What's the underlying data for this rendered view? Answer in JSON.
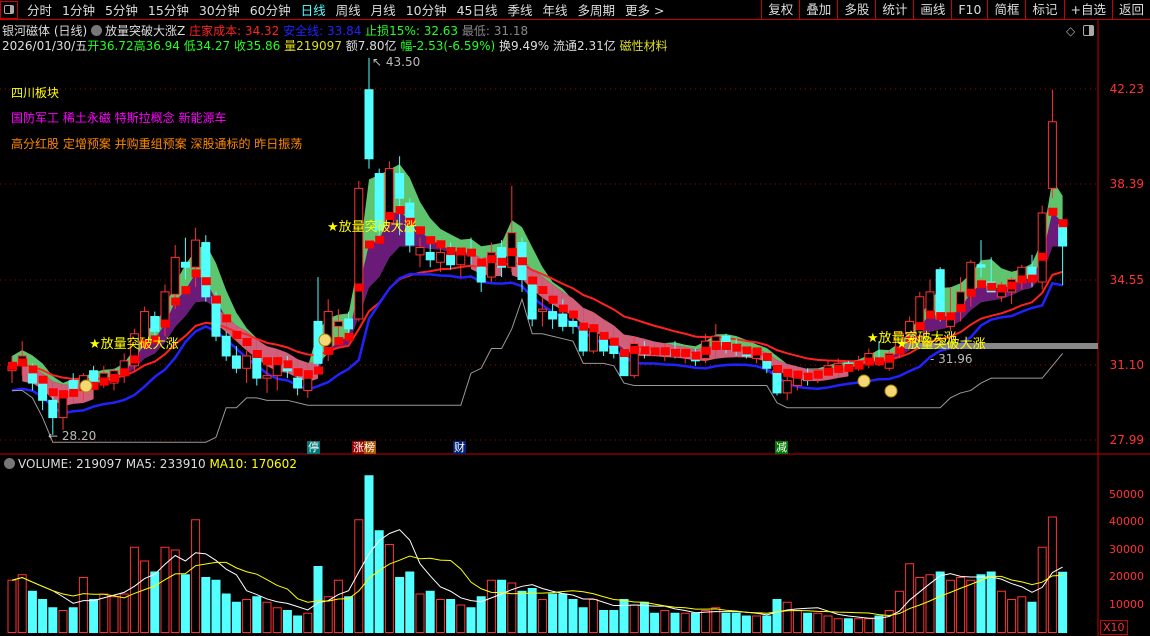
{
  "toolbar": {
    "periods": [
      "分时",
      "1分钟",
      "5分钟",
      "15分钟",
      "30分钟",
      "60分钟",
      "日线",
      "周线",
      "月线",
      "10分钟",
      "45日线",
      "季线",
      "年线",
      "多周期",
      "更多 >"
    ],
    "active": "日线",
    "right_buttons": [
      "复权",
      "叠加",
      "多股",
      "统计",
      "画线",
      "F10",
      "简框",
      "标记",
      "+自选",
      "返回"
    ]
  },
  "info": {
    "name": "银河磁体 (日线)",
    "indicator": "放量突破大涨Z",
    "cost_label": "庄家成本: 34.32",
    "safe_label": "安全线: 33.84",
    "stop_label": "止损15%: 32.63",
    "low_label": "最低: 31.18",
    "date": "2026/01/30/五",
    "open": "开36.72",
    "high": "高36.94",
    "low": "低34.27",
    "close": "收35.86",
    "vol": "量219097",
    "amount": "额7.80亿",
    "change": "幅-2.53(-6.59%)",
    "turnover": "换9.49%",
    "float": "流通2.31亿",
    "sector": "磁性材料"
  },
  "tags": {
    "line1": "四川板块",
    "line2": "国防军工 稀土永磁 特斯拉概念 新能源车",
    "line3": "高分红股 定增预案 并购重组预案 深股通标的 昨日振荡"
  },
  "annotations": {
    "signal": "★放量突破大涨",
    "high_mark": "43.50",
    "low_mark": "28.20",
    "level_mark": "31.96"
  },
  "markers": [
    "停",
    "涨榜",
    "财",
    "减"
  ],
  "colors": {
    "up": "#ff3232",
    "down": "#54ffff",
    "bg": "#000000",
    "axis": "#ff3232"
  },
  "volume_header": {
    "volume": "VOLUME: 219097",
    "ma5": "MA5: 233910",
    "ma10": "MA10: 170602",
    "unit": "X10"
  },
  "chart_data": {
    "type": "candlestick",
    "y_ticks": [
      "42.23",
      "38.39",
      "34.55",
      "31.10",
      "27.99"
    ],
    "ylim": [
      27.99,
      42.23
    ],
    "volume_ticks": [
      "50000",
      "40000",
      "30000",
      "20000",
      "10000"
    ],
    "ohlc": [
      [
        30.8,
        31.4,
        30.3,
        31.0
      ],
      [
        31.0,
        32.0,
        30.6,
        31.4
      ],
      [
        31.0,
        31.1,
        30.0,
        30.3
      ],
      [
        30.3,
        30.6,
        29.2,
        29.6
      ],
      [
        29.6,
        29.8,
        28.2,
        28.9
      ],
      [
        28.9,
        29.9,
        28.4,
        29.7
      ],
      [
        30.4,
        30.7,
        29.8,
        30.0
      ],
      [
        30.0,
        30.7,
        29.6,
        30.6
      ],
      [
        30.8,
        31.0,
        30.2,
        30.3
      ],
      [
        30.5,
        31.0,
        30.1,
        30.7
      ],
      [
        30.3,
        30.9,
        30.0,
        30.8
      ],
      [
        30.7,
        31.5,
        30.3,
        31.2
      ],
      [
        31.0,
        32.5,
        30.8,
        32.3
      ],
      [
        32.0,
        33.4,
        31.7,
        33.2
      ],
      [
        33.0,
        33.2,
        32.2,
        32.4
      ],
      [
        32.6,
        34.3,
        32.2,
        34.0
      ],
      [
        33.9,
        35.9,
        33.3,
        35.4
      ],
      [
        35.2,
        36.2,
        34.5,
        35.0
      ],
      [
        35.0,
        36.6,
        34.2,
        36.1
      ],
      [
        36.0,
        36.3,
        33.6,
        33.8
      ],
      [
        33.8,
        34.0,
        32.0,
        32.2
      ],
      [
        32.2,
        32.4,
        31.2,
        31.4
      ],
      [
        31.4,
        31.8,
        30.7,
        30.9
      ],
      [
        30.9,
        31.6,
        30.3,
        31.4
      ],
      [
        31.4,
        31.5,
        30.2,
        30.5
      ],
      [
        30.5,
        31.0,
        29.9,
        30.6
      ],
      [
        30.6,
        31.3,
        30.0,
        31.2
      ],
      [
        31.1,
        31.4,
        30.5,
        30.8
      ],
      [
        30.5,
        30.8,
        29.8,
        30.1
      ],
      [
        30.0,
        30.6,
        29.7,
        30.5
      ],
      [
        32.8,
        34.6,
        31.0,
        31.1
      ],
      [
        31.6,
        33.7,
        31.2,
        33.2
      ],
      [
        32.6,
        33.3,
        32.0,
        32.8
      ],
      [
        32.9,
        33.2,
        32.0,
        32.5
      ],
      [
        32.9,
        38.5,
        32.8,
        38.2
      ],
      [
        42.2,
        43.5,
        39.0,
        39.4
      ],
      [
        38.8,
        39.0,
        36.0,
        36.5
      ],
      [
        36.8,
        39.3,
        36.6,
        39.0
      ],
      [
        38.8,
        39.5,
        36.3,
        37.8
      ],
      [
        37.6,
        37.8,
        35.6,
        35.9
      ],
      [
        35.5,
        36.2,
        35.0,
        35.8
      ],
      [
        35.6,
        36.0,
        35.0,
        35.3
      ],
      [
        35.2,
        35.9,
        34.8,
        35.6
      ],
      [
        35.5,
        36.0,
        34.9,
        35.1
      ],
      [
        35.1,
        35.8,
        34.6,
        35.6
      ],
      [
        35.6,
        36.2,
        35.1,
        35.5
      ],
      [
        35.0,
        35.4,
        34.0,
        34.4
      ],
      [
        34.6,
        36.0,
        34.4,
        35.6
      ],
      [
        35.8,
        36.1,
        34.6,
        35.0
      ],
      [
        35.0,
        38.3,
        34.8,
        36.4
      ],
      [
        36.0,
        36.2,
        34.0,
        34.5
      ],
      [
        34.3,
        34.6,
        32.6,
        32.9
      ],
      [
        33.2,
        33.8,
        32.6,
        33.3
      ],
      [
        33.2,
        33.5,
        32.5,
        32.9
      ],
      [
        33.1,
        33.7,
        32.4,
        32.6
      ],
      [
        32.8,
        33.0,
        32.3,
        32.6
      ],
      [
        32.6,
        32.7,
        31.4,
        31.6
      ],
      [
        31.6,
        32.5,
        31.5,
        32.4
      ],
      [
        32.2,
        32.4,
        31.4,
        31.6
      ],
      [
        31.8,
        32.0,
        31.3,
        31.5
      ],
      [
        31.5,
        31.7,
        30.6,
        30.6
      ],
      [
        30.6,
        32.2,
        30.5,
        31.9
      ],
      [
        31.7,
        32.0,
        31.3,
        31.6
      ],
      [
        31.6,
        31.7,
        31.4,
        31.5
      ],
      [
        31.5,
        31.9,
        31.2,
        31.6
      ],
      [
        31.6,
        32.0,
        31.3,
        31.4
      ],
      [
        31.4,
        31.7,
        31.1,
        31.5
      ],
      [
        31.5,
        31.7,
        31.0,
        31.2
      ],
      [
        31.3,
        32.3,
        31.1,
        32.0
      ],
      [
        32.0,
        32.7,
        31.6,
        32.2
      ],
      [
        32.2,
        32.3,
        31.5,
        31.8
      ],
      [
        31.8,
        32.1,
        31.4,
        31.6
      ],
      [
        31.6,
        31.8,
        31.3,
        31.4
      ],
      [
        31.3,
        31.6,
        31.1,
        31.5
      ],
      [
        31.4,
        31.5,
        30.7,
        30.9
      ],
      [
        30.8,
        30.9,
        29.8,
        29.9
      ],
      [
        29.9,
        30.6,
        29.6,
        30.4
      ],
      [
        30.2,
        30.6,
        30.0,
        30.5
      ],
      [
        30.6,
        30.9,
        30.2,
        30.4
      ],
      [
        30.5,
        30.9,
        30.3,
        30.8
      ],
      [
        30.8,
        31.2,
        30.6,
        31.0
      ],
      [
        31.0,
        31.3,
        30.8,
        31.1
      ],
      [
        31.1,
        31.2,
        30.8,
        31.0
      ],
      [
        31.0,
        31.4,
        30.8,
        31.2
      ],
      [
        31.2,
        31.7,
        30.9,
        31.5
      ],
      [
        31.3,
        32.0,
        31.0,
        31.2
      ],
      [
        30.9,
        31.6,
        30.8,
        31.5
      ],
      [
        31.5,
        32.4,
        31.3,
        32.3
      ],
      [
        32.3,
        33.0,
        31.8,
        32.8
      ],
      [
        32.2,
        34.0,
        31.9,
        33.8
      ],
      [
        33.2,
        34.5,
        33.0,
        34.0
      ],
      [
        34.9,
        35.0,
        32.8,
        32.9
      ],
      [
        32.6,
        34.2,
        32.4,
        33.0
      ],
      [
        33.2,
        34.6,
        32.8,
        34.0
      ],
      [
        33.9,
        35.3,
        33.4,
        35.2
      ],
      [
        35.1,
        36.1,
        34.6,
        35.0
      ],
      [
        34.4,
        35.4,
        34.0,
        34.0
      ],
      [
        33.8,
        34.4,
        33.6,
        34.0
      ],
      [
        34.0,
        34.6,
        33.5,
        34.5
      ],
      [
        34.4,
        35.1,
        34.1,
        35.0
      ],
      [
        35.0,
        35.5,
        34.2,
        34.6
      ],
      [
        34.4,
        37.5,
        34.1,
        37.2
      ],
      [
        38.2,
        42.2,
        37.8,
        40.9
      ],
      [
        36.72,
        36.94,
        34.27,
        35.86
      ]
    ],
    "volume": [
      19000,
      21000,
      15000,
      12000,
      9000,
      8000,
      9000,
      20000,
      12000,
      14000,
      13000,
      14000,
      31000,
      26000,
      22000,
      31000,
      30000,
      21000,
      41000,
      20000,
      19000,
      14000,
      11000,
      12000,
      13000,
      11000,
      9000,
      8000,
      6000,
      7000,
      24000,
      13000,
      19000,
      13000,
      41000,
      57000,
      37000,
      32000,
      20000,
      22000,
      14000,
      15000,
      12000,
      12000,
      10000,
      9000,
      13000,
      19000,
      19000,
      18000,
      15000,
      16000,
      12000,
      14000,
      14000,
      12000,
      9000,
      12000,
      8000,
      8000,
      12000,
      10000,
      11000,
      7000,
      8000,
      7000,
      7000,
      7000,
      8000,
      9000,
      7000,
      7000,
      6000,
      6000,
      6000,
      12000,
      11000,
      8000,
      7000,
      7000,
      6000,
      5000,
      5000,
      5000,
      5000,
      6000,
      8000,
      15000,
      25000,
      20000,
      21000,
      22000,
      19000,
      20000,
      19000,
      21000,
      22000,
      15000,
      12000,
      13000,
      11000,
      31000,
      42000,
      21910
    ]
  }
}
